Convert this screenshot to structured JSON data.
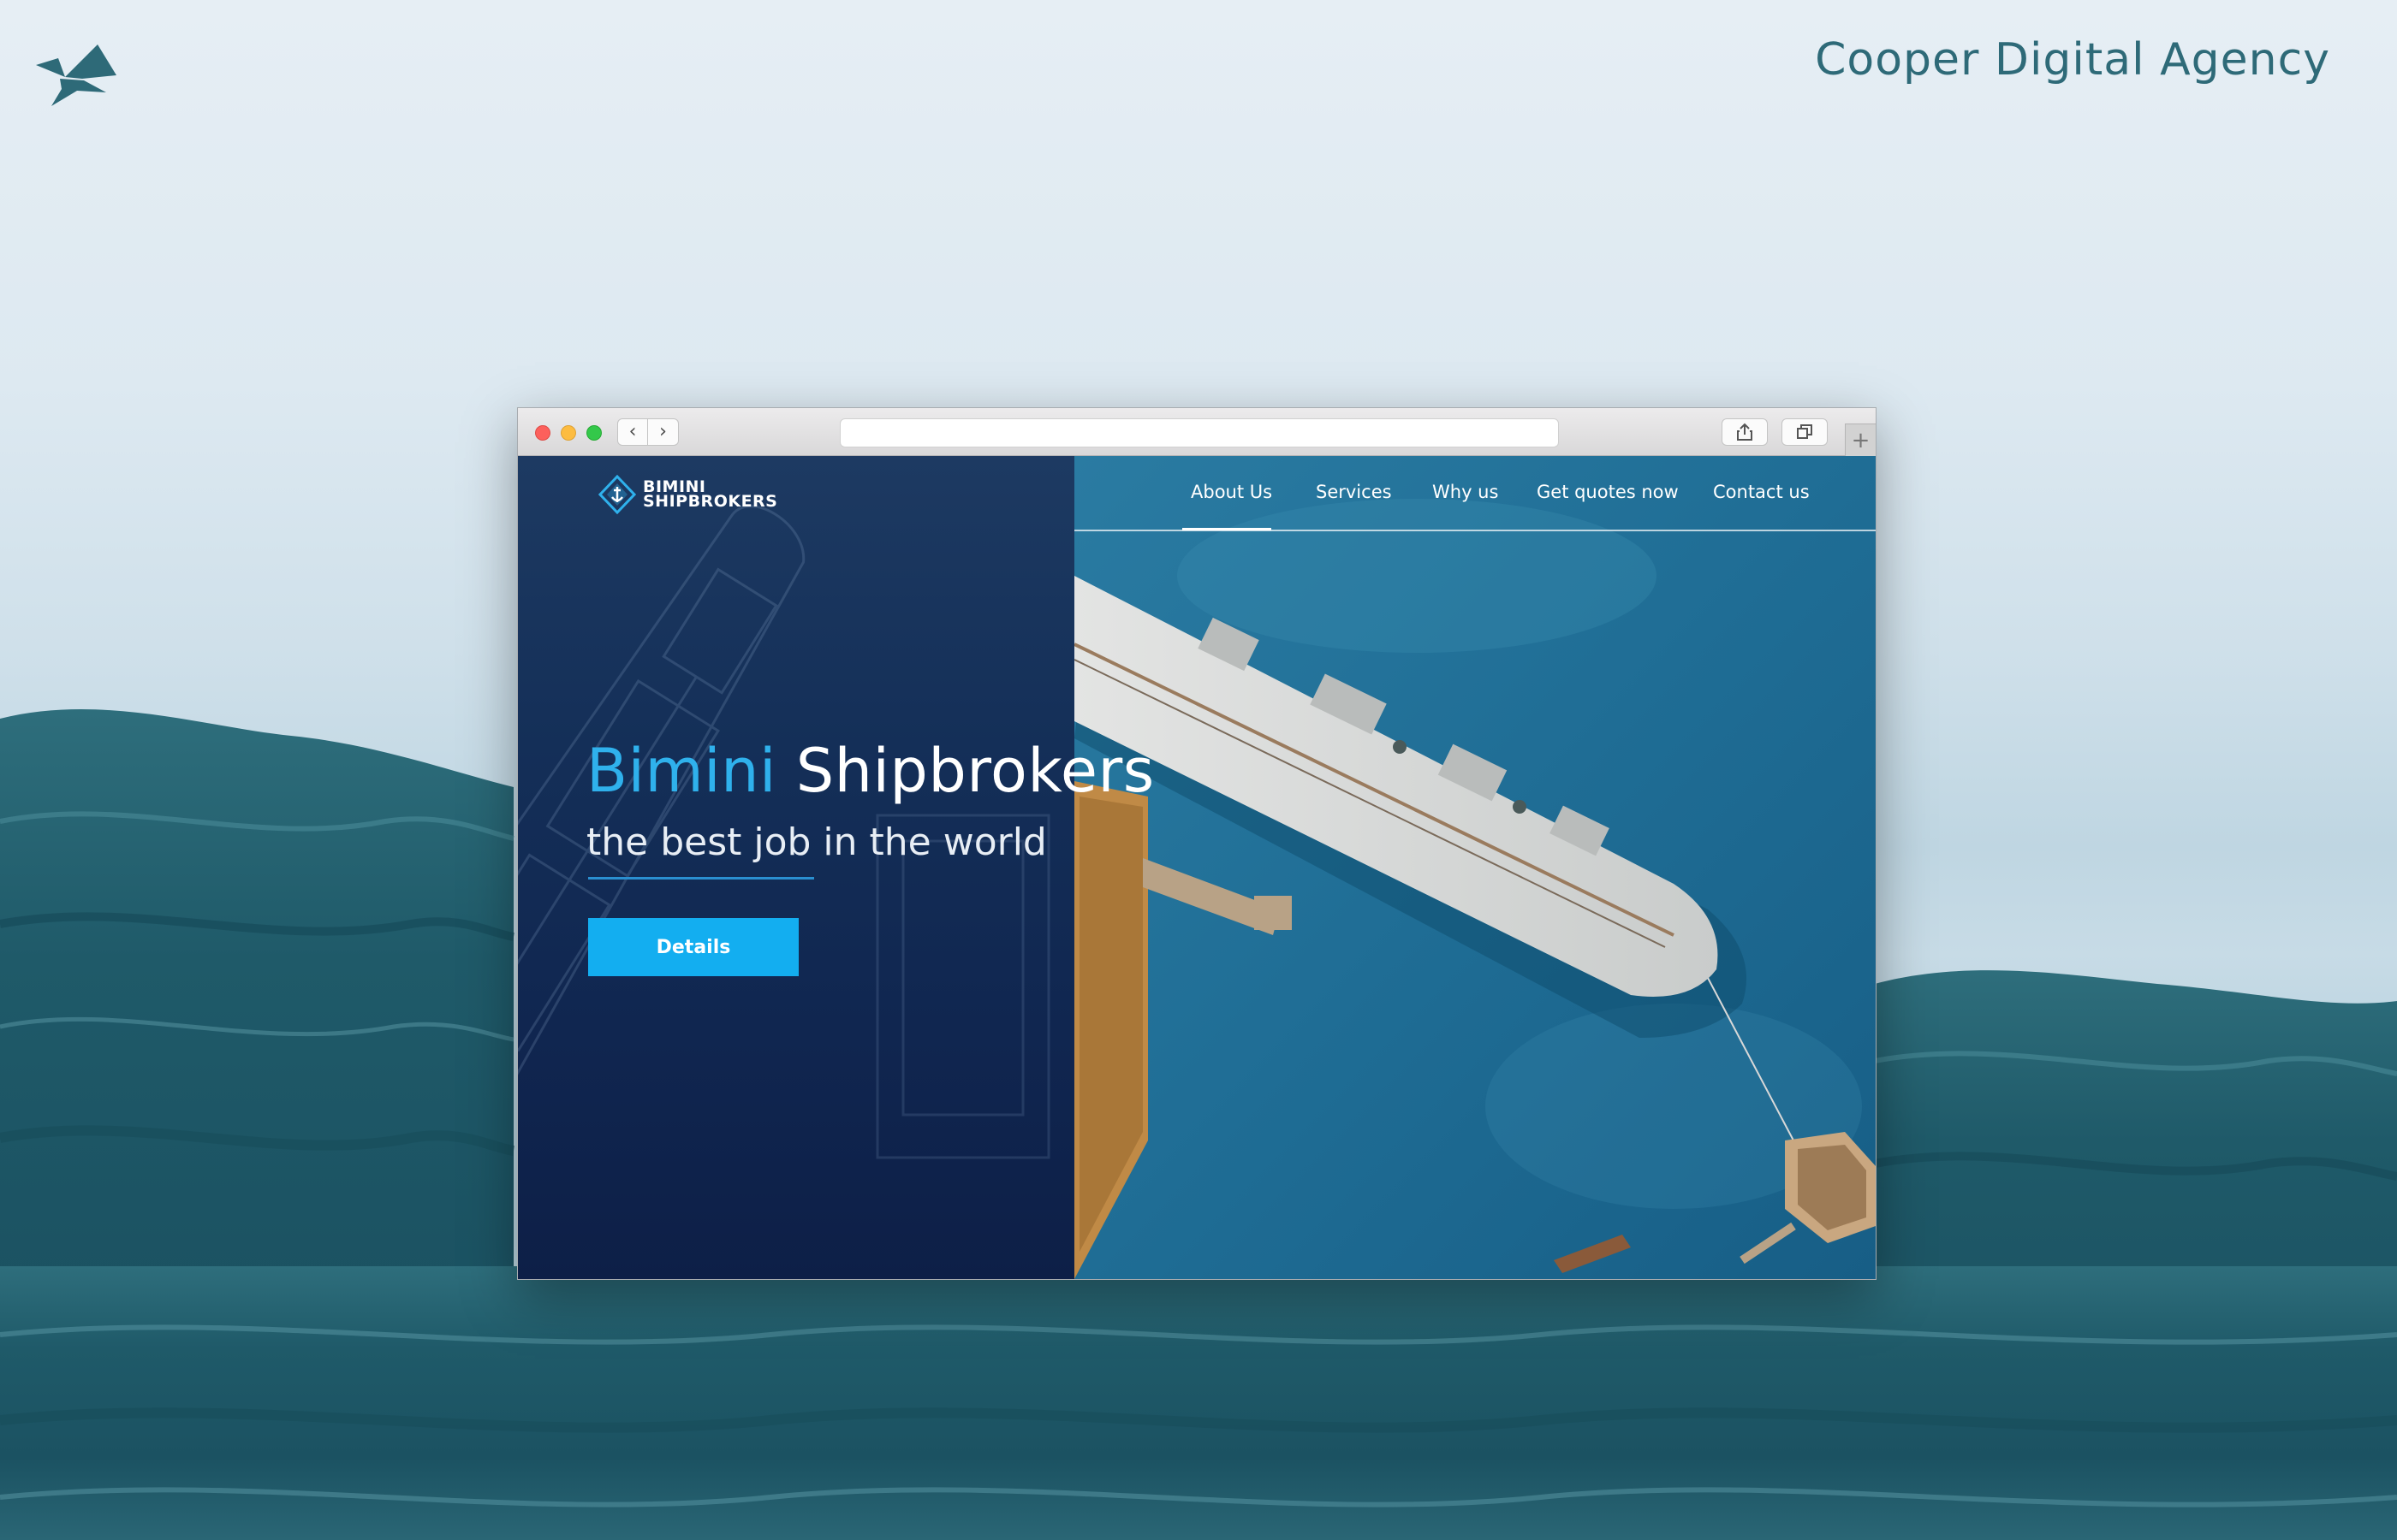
{
  "agency": {
    "name": "Cooper Digital Agency",
    "logo_icon": "bird-icon",
    "brand_color": "#2e6a78"
  },
  "browser": {
    "controls": [
      "close",
      "minimize",
      "zoom"
    ],
    "back_glyph": "‹",
    "forward_glyph": "›",
    "address_value": "",
    "new_tab_glyph": "+"
  },
  "site": {
    "logo": {
      "line1": "BIMINI",
      "line2": "SHIPBROKERS",
      "icon": "diamond-anchor-icon"
    },
    "nav": {
      "items": [
        {
          "label": "About Us",
          "active": true
        },
        {
          "label": "Services",
          "active": false
        },
        {
          "label": "Why us",
          "active": false
        },
        {
          "label": "Get quotes now",
          "active": false
        },
        {
          "label": "Contact us",
          "active": false
        }
      ]
    },
    "hero": {
      "title_accent": "Bimini",
      "title_rest": "Shipbrokers",
      "subtitle": "the best job in the world",
      "cta_label": "Details"
    },
    "colors": {
      "accent": "#2fb1ec",
      "button": "#13aef0",
      "panel": "#102650"
    }
  }
}
